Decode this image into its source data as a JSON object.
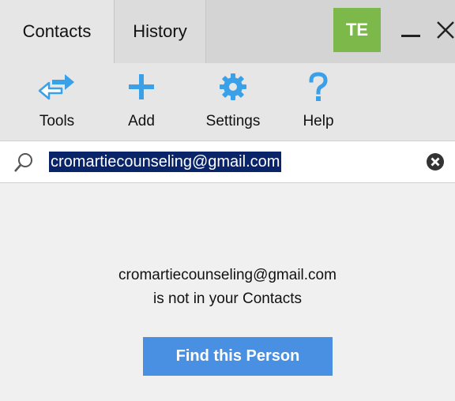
{
  "tabs": {
    "contacts": "Contacts",
    "history": "History"
  },
  "user_badge": "TE",
  "toolbar": {
    "tools_label": "Tools",
    "add_label": "Add",
    "settings_label": "Settings",
    "help_label": "Help"
  },
  "search": {
    "value": "cromartiecounseling@gmail.com"
  },
  "message": {
    "email": "cromartiecounseling@gmail.com",
    "status": "is not in your Contacts",
    "action_label": "Find this Person"
  },
  "colors": {
    "accent_blue": "#4a90e2",
    "icon_blue": "#3aa0e8",
    "badge_green": "#7cb94a",
    "selection": "#0a246a"
  },
  "icons": {
    "tools": "arrows-swap-icon",
    "add": "plus-icon",
    "settings": "gear-icon",
    "help": "question-icon",
    "search": "search-icon",
    "clear": "clear-icon"
  }
}
